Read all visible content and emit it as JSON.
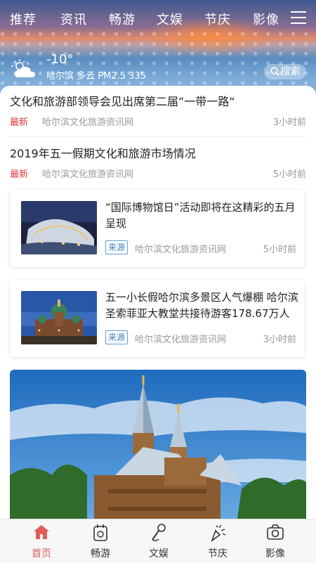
{
  "nav": {
    "tabs": [
      "推荐",
      "资讯",
      "畅游",
      "文娱",
      "节庆",
      "影像"
    ],
    "active_tab": "节庆"
  },
  "weather": {
    "temperature": "-10°",
    "info": "哈尔滨 多云 PM2.5 335"
  },
  "search": {
    "label": "搜索"
  },
  "news_text": [
    {
      "title": "文化和旅游部领导会见出席第二届“一带一路“",
      "tag": "最新",
      "source": "哈尔滨文化旅游资讯网",
      "time": "3小时前"
    },
    {
      "title": "2019年五一假期文化和旅游市场情况",
      "tag": "最新",
      "source": "哈尔滨文化旅游资讯网",
      "time": "5小时前"
    }
  ],
  "news_cards": [
    {
      "title": "“国际博物馆日”活动即将在这精彩的五月呈现",
      "badge": "来源",
      "source": "哈尔滨文化旅游资讯网",
      "time": "5小时前"
    },
    {
      "title": "五一小长假哈尔滨多景区人气爆棚 哈尔滨圣索菲亚大教堂共接待游客178.67万人",
      "badge": "来源",
      "source": "哈尔滨文化旅游资讯网",
      "time": "3小时前"
    }
  ],
  "tabbar": {
    "items": [
      {
        "label": "首页",
        "icon": "home-icon"
      },
      {
        "label": "畅游",
        "icon": "tour-icon"
      },
      {
        "label": "文娱",
        "icon": "microphone-icon"
      },
      {
        "label": "节庆",
        "icon": "firework-icon"
      },
      {
        "label": "影像",
        "icon": "camera-icon"
      }
    ],
    "active": "首页",
    "active_color": "#e35a5a"
  },
  "colors": {
    "accent_red": "#e23a3a",
    "badge_blue": "#3a7fc4"
  }
}
